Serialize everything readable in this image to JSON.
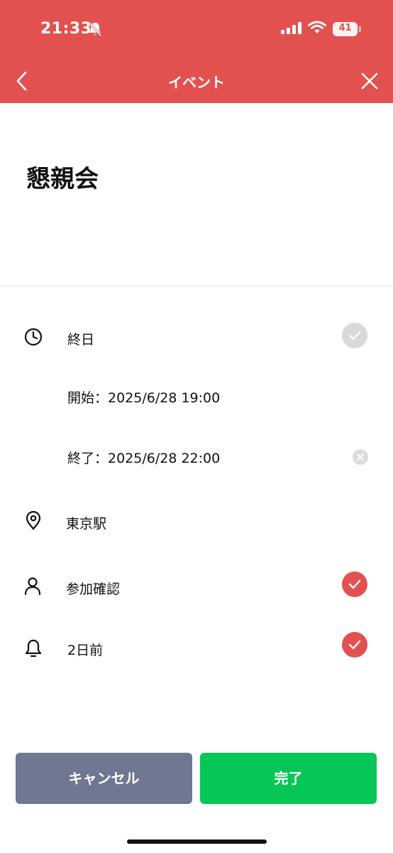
{
  "status_bar": {
    "time": "21:33",
    "battery": "41",
    "icons": [
      "bell-off-icon",
      "signal-icon",
      "wifi-icon",
      "battery-icon"
    ]
  },
  "nav": {
    "title": "イベント",
    "back_icon": "chevron-left-icon",
    "close_icon": "close-icon"
  },
  "event": {
    "title": "懇親会"
  },
  "details": {
    "all_day": {
      "label": "終日",
      "icon": "clock-icon",
      "checked": false
    },
    "start": "開始：2025/6/28 19:00",
    "end": "終了：2025/6/28 22:00",
    "location": {
      "label": "東京駅",
      "icon": "location-pin-icon"
    },
    "attendance": {
      "label": "参加確認",
      "icon": "person-icon",
      "checked": true
    },
    "reminder": {
      "label": "2日前",
      "icon": "bell-icon",
      "checked": true
    }
  },
  "buttons": {
    "cancel": "キャンセル",
    "done": "完了"
  },
  "colors": {
    "header": "#e25150",
    "cancel": "#6f7791",
    "done": "#06c755",
    "check_on": "#e25150",
    "check_off": "#d9d9d9"
  }
}
